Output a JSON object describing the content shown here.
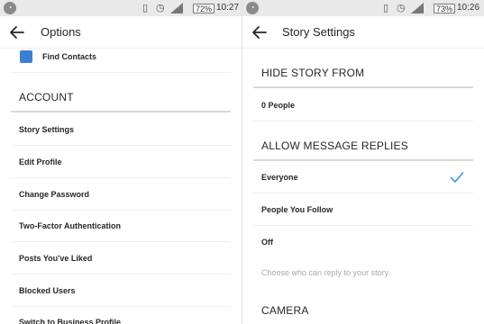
{
  "left": {
    "status": {
      "battery": "72%",
      "time": "10:27"
    },
    "title": "Options",
    "find_contacts": "Find Contacts",
    "section": "ACCOUNT",
    "items": [
      {
        "label": "Story Settings"
      },
      {
        "label": "Edit Profile"
      },
      {
        "label": "Change Password"
      },
      {
        "label": "Two-Factor Authentication"
      },
      {
        "label": "Posts You've Liked"
      },
      {
        "label": "Blocked Users"
      },
      {
        "label": "Switch to Business Profile"
      }
    ]
  },
  "right": {
    "status": {
      "battery": "73%",
      "time": "10:26"
    },
    "title": "Story Settings",
    "hide_section": "HIDE STORY FROM",
    "hide_value": "0 People",
    "replies_section": "ALLOW MESSAGE REPLIES",
    "reply_options": [
      {
        "label": "Everyone",
        "selected": true
      },
      {
        "label": "People You Follow",
        "selected": false
      },
      {
        "label": "Off",
        "selected": false
      }
    ],
    "replies_hint": "Choose who can reply to your story.",
    "camera_section": "CAMERA"
  },
  "colors": {
    "accent": "#3897f0",
    "contact_icon": "#3d7fd4",
    "statusbar": "#e9e9e9"
  }
}
